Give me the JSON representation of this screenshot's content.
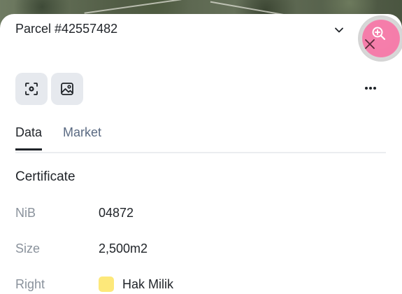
{
  "header": {
    "title": "Parcel #42557482"
  },
  "toolbar": {
    "tools": [
      {
        "icon": "scan-focus-icon"
      },
      {
        "icon": "image-icon"
      }
    ],
    "more_icon": "more-horizontal-icon"
  },
  "tabs": [
    {
      "label": "Data",
      "active": true
    },
    {
      "label": "Market",
      "active": false
    }
  ],
  "certificate": {
    "section_title": "Certificate",
    "rows": [
      {
        "label": "NiB",
        "value": "04872"
      },
      {
        "label": "Size",
        "value": "2,500m2"
      },
      {
        "label": "Right",
        "value": "Hak Milik",
        "swatch_color": "#fde87a"
      }
    ]
  },
  "colors": {
    "accent_pink": "#f67caa",
    "tool_bg": "#e6e9ee",
    "text_primary": "#1f2328",
    "text_secondary": "#8a929c",
    "tab_inactive": "#5a6a82"
  }
}
